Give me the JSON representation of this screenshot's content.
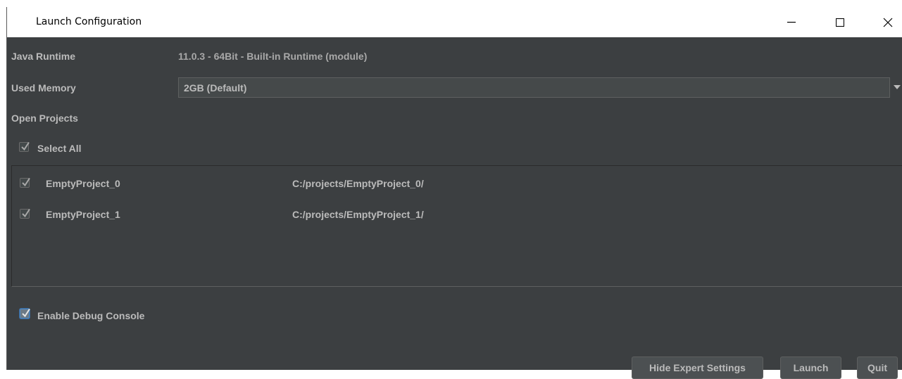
{
  "window": {
    "title": "Launch Configuration",
    "controls": {
      "minimize": "minimize-icon",
      "maximize": "maximize-icon",
      "close": "close-icon"
    }
  },
  "runtime": {
    "label": "Java Runtime",
    "value": "11.0.3 - 64Bit - Built-in Runtime (module)"
  },
  "memory": {
    "label": "Used Memory",
    "selected": "2GB (Default)"
  },
  "open_projects": {
    "label": "Open Projects",
    "select_all": {
      "label": "Select All",
      "checked": true
    },
    "items": [
      {
        "name": "EmptyProject_0",
        "path": "C:/projects/EmptyProject_0/",
        "checked": true
      },
      {
        "name": "EmptyProject_1",
        "path": "C:/projects/EmptyProject_1/",
        "checked": true
      }
    ]
  },
  "debug_console": {
    "label": "Enable Debug Console",
    "checked": true
  },
  "buttons": {
    "hide_expert": "Hide Expert Settings",
    "launch": "Launch",
    "quit": "Quit"
  },
  "colors": {
    "background": "#3c3f41",
    "text": "#bbbbbb",
    "button": "#4c5052",
    "focus": "#4a88c7"
  }
}
